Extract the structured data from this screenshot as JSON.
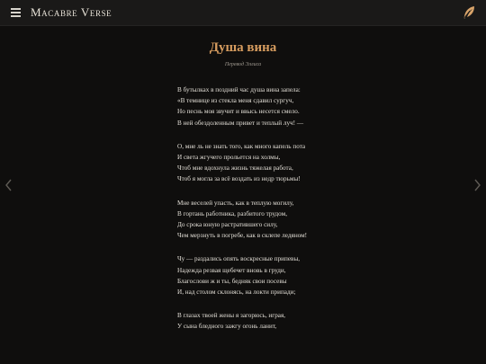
{
  "header": {
    "brand": "Macabre Verse",
    "menu_icon": "hamburger-menu-icon",
    "action_icon": "feather-quill-icon"
  },
  "nav": {
    "prev_icon": "chevron-left-icon",
    "next_icon": "chevron-right-icon"
  },
  "poem": {
    "title": "Душа вина",
    "subtitle": "Перевод Эллиса",
    "stanzas": [
      {
        "lines": [
          "В бутылках в поздний час душа вина запела:",
          "«В темнице из стекла меня сдавил сургуч,",
          "Но песнь моя звучит и ввысь несется смело.",
          "В ней обездоленным привет и теплый луч! —"
        ]
      },
      {
        "lines": [
          "О, мне ль не знать того, как много капель пота",
          "И света жгучего прольется на холмы,",
          "Чтоб мне вдохнула жизнь тяжелая работа,",
          "Чтоб я могла за всё воздать из недр тюрьмы!"
        ]
      },
      {
        "lines": [
          "Мне веселей упасть, как в теплую могилу,",
          "В гортань работника, разбитого трудом,",
          "До срока юную растратившего силу,",
          "Чем мерзнуть в погребе, как в склепе ледяном!"
        ]
      },
      {
        "lines": [
          "Чу — раздались опять воскресные припевы,",
          "Надежда резвая щебечет вновь в груди,",
          "Благослови ж и ты, бедняк свои посевы",
          "И, над столом склонясь, на локти припади;"
        ]
      },
      {
        "lines": [
          "В глазах твоей жены я загорюсь, играя,",
          "У сына бледного зажгу огонь ланит,"
        ]
      }
    ]
  },
  "colors": {
    "background": "#0f0e0d",
    "topbar": "#1a1918",
    "title_accent": "#d69c5f",
    "text": "#e2ded6"
  }
}
